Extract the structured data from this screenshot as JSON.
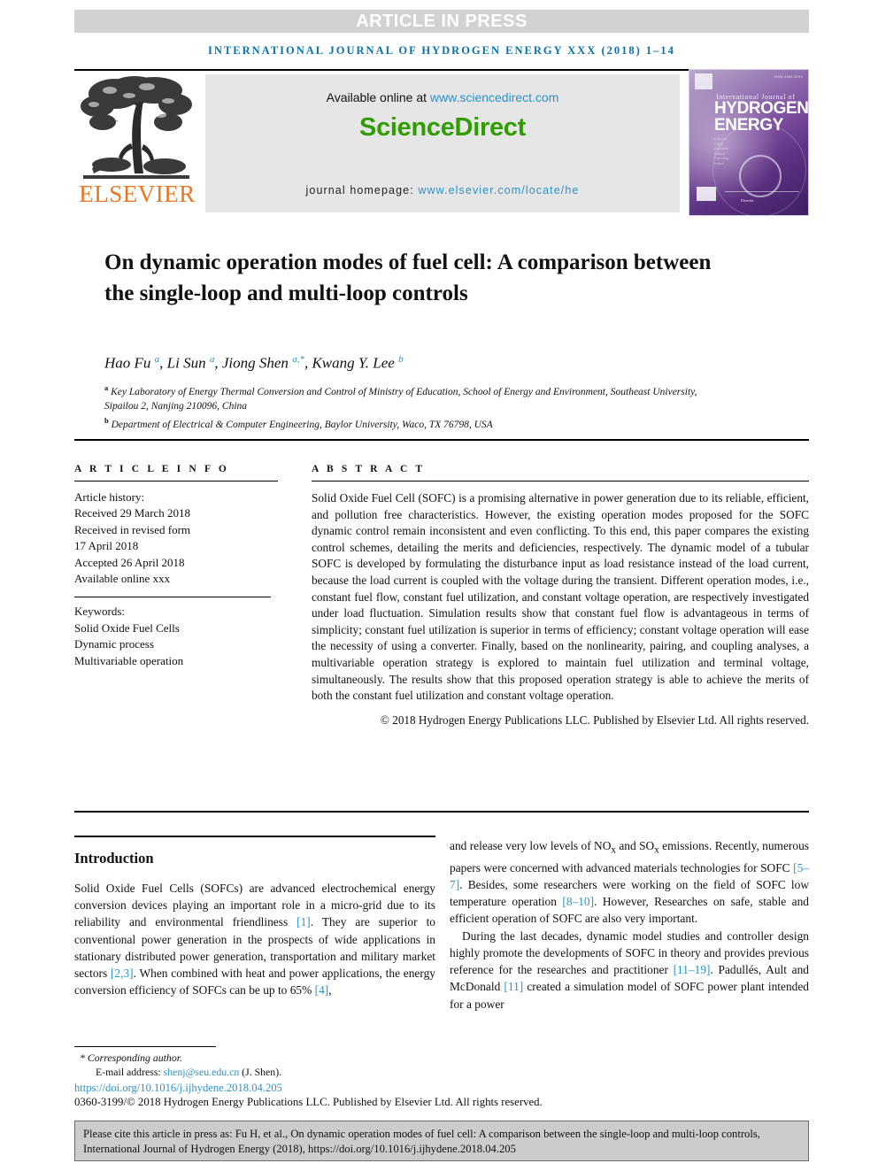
{
  "banner": {
    "text": "ARTICLE IN PRESS"
  },
  "journal_line": "INTERNATIONAL JOURNAL OF HYDROGEN ENERGY XXX (2018) 1–14",
  "masthead": {
    "publisher_name": "ELSEVIER",
    "available_prefix": "Available online at ",
    "available_url": "www.sciencedirect.com",
    "sciencedirect_logo": "ScienceDirect",
    "homepage_prefix": "journal homepage: ",
    "homepage_url": "www.elsevier.com/locate/he",
    "cover": {
      "issn": "ISSN 0360-3199",
      "line1": "International Journal of",
      "line2": "HYDROGEN",
      "line3": "ENERGY",
      "editors_label_1": "Editor-in-Chief",
      "editors_label_2": "Associate Editors",
      "editors_label_3": "Founding Editor",
      "publisher": "Elsevier"
    }
  },
  "article": {
    "title": "On dynamic operation modes of fuel cell: A comparison between the single-loop and multi-loop controls",
    "authors_html": "Hao Fu <sup>a</sup>, Li Sun <sup>a</sup>, Jiong Shen <sup>a,*</sup>, Kwang Y. Lee <sup>b</sup>",
    "affiliation_a": "Key Laboratory of Energy Thermal Conversion and Control of Ministry of Education, School of Energy and Environment, Southeast University, Sipailou 2, Nanjing 210096, China",
    "affiliation_b": "Department of Electrical & Computer Engineering, Baylor University, Waco, TX 76798, USA",
    "affil_marker_a": "a",
    "affil_marker_b": "b"
  },
  "article_info": {
    "heading": "A R T I C L E   I N F O",
    "history_label": "Article history:",
    "received": "Received 29 March 2018",
    "revised_label": "Received in revised form",
    "revised_date": "17 April 2018",
    "accepted": "Accepted 26 April 2018",
    "available_online": "Available online xxx",
    "keywords_label": "Keywords:",
    "keywords": [
      "Solid Oxide Fuel Cells",
      "Dynamic process",
      "Multivariable operation"
    ]
  },
  "abstract": {
    "heading": "A B S T R A C T",
    "text": "Solid Oxide Fuel Cell (SOFC) is a promising alternative in power generation due to its reliable, efficient, and pollution free characteristics. However, the existing operation modes proposed for the SOFC dynamic control remain inconsistent and even conflicting. To this end, this paper compares the existing control schemes, detailing the merits and deficiencies, respectively. The dynamic model of a tubular SOFC is developed by formulating the disturbance input as load resistance instead of the load current, because the load current is coupled with the voltage during the transient. Different operation modes, i.e., constant fuel flow, constant fuel utilization, and constant voltage operation, are respectively investigated under load fluctuation. Simulation results show that constant fuel flow is advantageous in terms of simplicity; constant fuel utilization is superior in terms of efficiency; constant voltage operation will ease the necessity of using a converter. Finally, based on the nonlinearity, pairing, and coupling analyses, a multivariable operation strategy is explored to maintain fuel utilization and terminal voltage, simultaneously. The results show that this proposed operation strategy is able to achieve the merits of both the constant fuel utilization and constant voltage operation.",
    "copyright": "© 2018 Hydrogen Energy Publications LLC. Published by Elsevier Ltd. All rights reserved."
  },
  "body": {
    "intro_heading": "Introduction",
    "left_paragraph_1_html": "Solid Oxide Fuel Cells (SOFCs) are advanced electrochemical energy conversion devices playing an important role in a micro-grid due to its reliability and environmental friendliness <span class=\"ref\">[1]</span>. They are superior to conventional power generation in the prospects of wide applications in stationary distributed power generation, transportation and military market sectors <span class=\"ref\">[2,3]</span>. When combined with heat and power applications, the energy conversion efficiency of SOFCs can be up to 65% <span class=\"ref\">[4]</span>,",
    "right_paragraph_1_html": "and release very low levels of NO<sub>x</sub> and SO<sub>x</sub> emissions. Recently, numerous papers were concerned with advanced materials technologies for SOFC <span class=\"ref\">[5–7]</span>. Besides, some researchers were working on the field of SOFC low temperature operation <span class=\"ref\">[8–10]</span>. However, Researches on safe, stable and efficient operation of SOFC are also very important.",
    "right_paragraph_2_html": "During the last decades, dynamic model studies and controller design highly promote the developments of SOFC in theory and provides previous reference for the researches and practitioner <span class=\"ref\">[11–19]</span>. Padullés, Ault and McDonald <span class=\"ref\">[11]</span> created a simulation model of SOFC power plant intended for a power"
  },
  "footnote": {
    "corresponding": "Corresponding author.",
    "star": "*",
    "email_label": "E-mail address: ",
    "email": "shenj@seu.edu.cn",
    "email_owner": " (J. Shen).",
    "doi": "https://doi.org/10.1016/j.ijhydene.2018.04.205",
    "issn_copyright": "0360-3199/© 2018 Hydrogen Energy Publications LLC. Published by Elsevier Ltd. All rights reserved."
  },
  "cite_box": {
    "text": "Please cite this article in press as: Fu H, et al., On dynamic operation modes of fuel cell: A comparison between the single-loop and multi-loop controls, International Journal of Hydrogen Energy (2018), https://doi.org/10.1016/j.ijhydene.2018.04.205"
  },
  "colors": {
    "link": "#2b93c8",
    "sciencedirect_green": "#2f9c00",
    "elsevier_orange": "#e87722",
    "journal_line": "#0b72a8",
    "banner_bg": "#d2d2d2",
    "cite_bg": "#cccccc"
  }
}
